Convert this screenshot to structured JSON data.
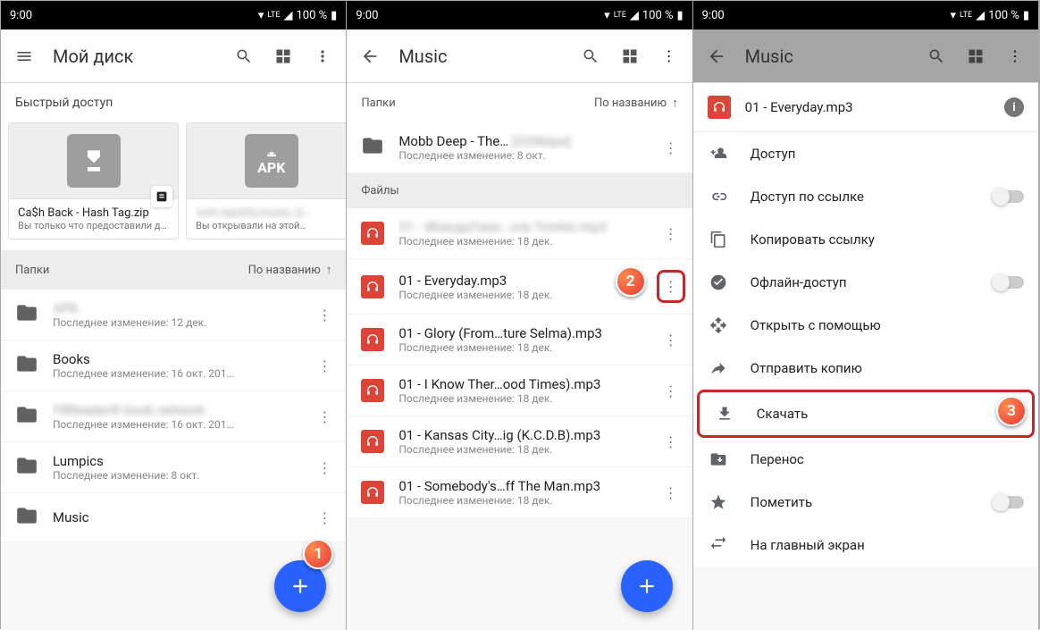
{
  "statusbar": {
    "time": "9:00",
    "battery": "100 %",
    "net": "LTE"
  },
  "screen1": {
    "title": "Мой диск",
    "quick_header": "Быстрый доступ",
    "quick": [
      {
        "title": "Ca$h Back - Hash Tag.zip",
        "sub": "Вы только что предоставили д…",
        "badge": "zip"
      },
      {
        "title": "com.spotify.music_8…",
        "sub": "Вы открывали на этой…",
        "badge": "APK"
      }
    ],
    "folders_label": "Папки",
    "sort_label": "По названию",
    "folders": [
      {
        "title": "APK",
        "sub": "Последнее изменение: 12 дек.",
        "blur": true
      },
      {
        "title": "Books",
        "sub": "Последнее изменение: 16 окт. 201…"
      },
      {
        "title": "FBReader® book network",
        "sub": "Последнее изменение: 16 окт. 201…",
        "blur": true
      },
      {
        "title": "Lumpics",
        "sub": "Последнее изменение: 8 окт."
      },
      {
        "title": "Music",
        "sub": ""
      }
    ]
  },
  "screen2": {
    "title": "Music",
    "folders_label": "Папки",
    "sort_label": "По названию",
    "folder": {
      "title": "Mobb Deep - The…",
      "sub": "Последнее изменение: 8 окт."
    },
    "files_label": "Файлы",
    "files": [
      {
        "title": "01 - #БандаТаял…ony Tonite).mp3",
        "sub": "Последнее изменение: 18 дек.",
        "blur": true
      },
      {
        "title": "01 - Everyday.mp3",
        "sub": "Последнее изменение: 18 дек."
      },
      {
        "title": "01 - Glory (From…ture Selma).mp3",
        "sub": "Последнее изменение: 18 дек."
      },
      {
        "title": "01 - I Know Ther…ood Times).mp3",
        "sub": "Последнее изменение: 18 дек."
      },
      {
        "title": "01 - Kansas City…ig (K.C.D.B).mp3",
        "sub": "Последнее изменение: 18 дек."
      },
      {
        "title": "01 - Somebody's…ff The Man.mp3",
        "sub": "Последнее изменение: 18 дек."
      }
    ]
  },
  "screen3": {
    "title": "Music",
    "file": "01 - Everyday.mp3",
    "menu": [
      {
        "icon": "share-person",
        "label": "Доступ"
      },
      {
        "icon": "link",
        "label": "Доступ по ссылке",
        "toggle": true
      },
      {
        "icon": "copy",
        "label": "Копировать ссылку"
      },
      {
        "icon": "offline",
        "label": "Офлайн-доступ",
        "toggle": true
      },
      {
        "icon": "open-with",
        "label": "Открыть с помощью"
      },
      {
        "icon": "send",
        "label": "Отправить копию"
      },
      {
        "icon": "download",
        "label": "Скачать",
        "highlight": true
      },
      {
        "icon": "move",
        "label": "Перенос"
      },
      {
        "icon": "star",
        "label": "Пометить",
        "toggle": true
      },
      {
        "icon": "home",
        "label": "На главный экран"
      }
    ]
  },
  "markers": {
    "m1": "1",
    "m2": "2",
    "m3": "3"
  }
}
